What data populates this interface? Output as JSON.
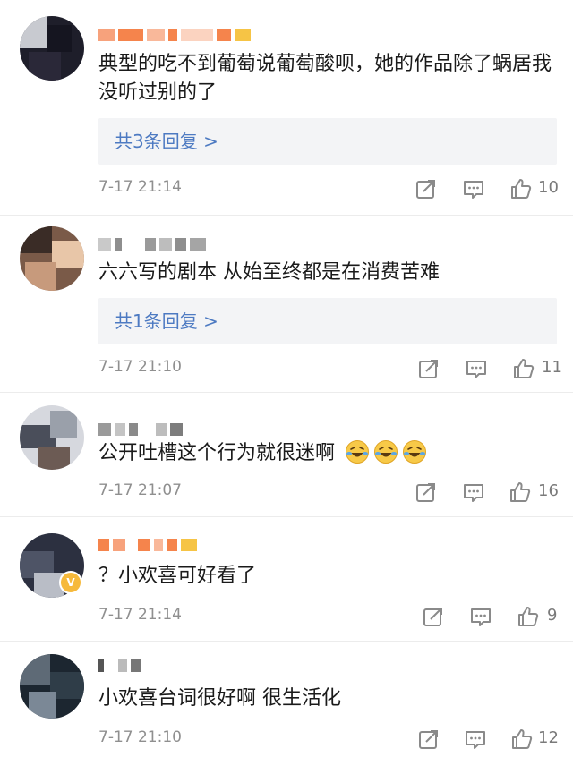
{
  "comments": [
    {
      "content": "典型的吃不到葡萄说葡萄酸呗，她的作品除了蜗居我没听过别的了",
      "replies_label": "共3条回复 >",
      "time": "7-17 21:14",
      "likes": "10",
      "verified": false
    },
    {
      "content": "六六写的剧本 从始至终都是在消费苦难",
      "replies_label": "共1条回复 >",
      "time": "7-17 21:10",
      "likes": "11",
      "verified": false
    },
    {
      "content": "公开吐槽这个行为就很迷啊",
      "emojis": [
        "laugh-cry-emoji",
        "laugh-cry-emoji",
        "laugh-cry-emoji"
      ],
      "time": "7-17 21:07",
      "likes": "16",
      "verified": false
    },
    {
      "content": "？小欢喜可好看了",
      "time": "7-17 21:14",
      "likes": "9",
      "verified": true,
      "verified_badge": "V"
    },
    {
      "content": "小欢喜台词很好啊 很生活化",
      "time": "7-17 21:10",
      "likes": "12",
      "verified": false
    }
  ],
  "icons": {
    "share": "share-icon",
    "comment": "comment-icon",
    "like": "thumbs-up-icon"
  },
  "colors": {
    "reply_link": "#4d7ac2",
    "reply_box": "#f3f4f6",
    "meta_text": "#8f8f8f",
    "vip_orange": "#f5844c",
    "verified_badge": "#f6b93b"
  }
}
